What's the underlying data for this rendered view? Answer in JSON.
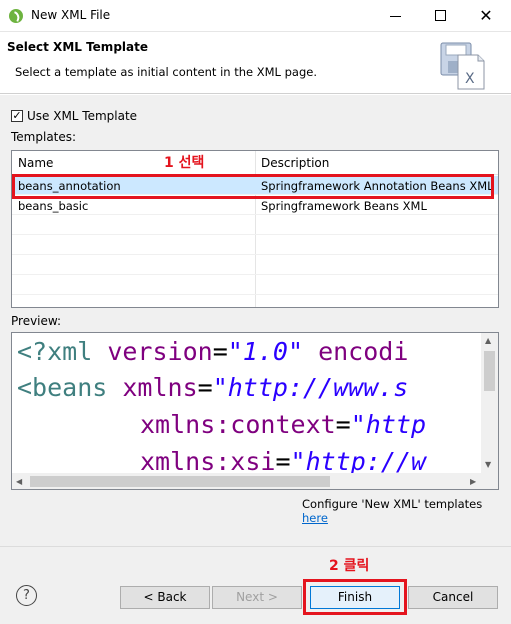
{
  "window": {
    "title": "New XML File"
  },
  "header": {
    "title": "Select XML Template",
    "description": "Select a template as initial content in the XML page."
  },
  "use_template": {
    "label": "Use XML Template",
    "checked": true
  },
  "templates": {
    "label": "Templates:",
    "columns": [
      "Name",
      "Description"
    ],
    "rows": [
      {
        "name": "beans_annotation",
        "description": "Springframework Annotation Beans XML",
        "selected": true
      },
      {
        "name": "beans_basic",
        "description": "Springframework Beans XML",
        "selected": false
      }
    ]
  },
  "annotations": {
    "select": "1 선택",
    "click": "2 클릭",
    "color": "#e4141e"
  },
  "preview": {
    "label": "Preview:",
    "lines": [
      [
        "<?xml",
        " version",
        "=",
        "\"1.0\"",
        " encodi"
      ],
      [
        "<beans",
        " xmlns",
        "=",
        "\"http://www.s",
        ""
      ],
      [
        "",
        "xmlns:context",
        "=",
        "\"http",
        ""
      ],
      [
        "",
        "xmlns:xsi",
        "=",
        "\"http://w",
        ""
      ]
    ]
  },
  "configure": {
    "text": "Configure 'New XML' templates",
    "link": "here"
  },
  "buttons": {
    "back": "< Back",
    "next": "Next >",
    "finish": "Finish",
    "cancel": "Cancel"
  },
  "icons": {
    "app": "spring-leaf-icon",
    "help": "help-icon",
    "header": "xml-file-save-icon"
  }
}
